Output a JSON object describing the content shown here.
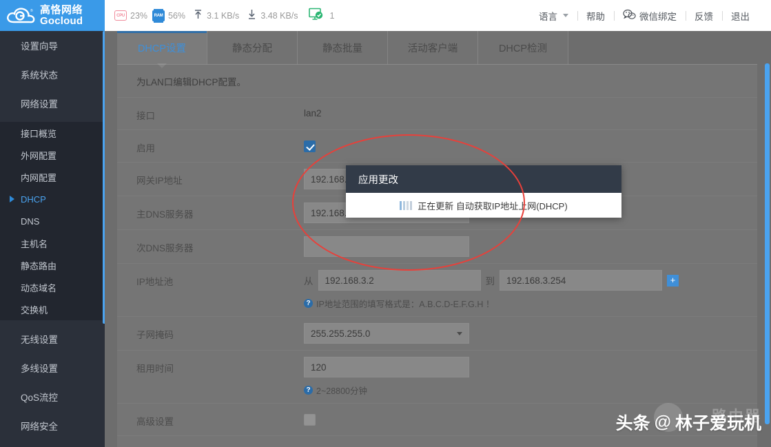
{
  "brand": {
    "cn": "高恪网络",
    "en": "Gocloud",
    "logo_icon": "cloud-logo-icon"
  },
  "header": {
    "stats": [
      {
        "icon": "cpu-icon",
        "label": "CPU",
        "value": "23%"
      },
      {
        "icon": "ram-icon",
        "label": "RAM",
        "value": "56%"
      },
      {
        "icon": "upload-arrow-icon",
        "value": "3.1 KB/s"
      },
      {
        "icon": "download-arrow-icon",
        "value": "3.48 KB/s"
      },
      {
        "icon": "device-online-icon",
        "value": "1"
      }
    ],
    "menu": [
      {
        "label": "语言",
        "icon": "chevron-down-icon"
      },
      {
        "label": "帮助"
      },
      {
        "label": "微信绑定",
        "icon": "wechat-icon"
      },
      {
        "label": "反馈"
      },
      {
        "label": "退出"
      }
    ]
  },
  "sidebar": {
    "items": [
      {
        "label": "设置向导"
      },
      {
        "label": "系统状态"
      },
      {
        "label": "网络设置"
      }
    ],
    "sub_items": [
      {
        "label": "接口概览",
        "active": false
      },
      {
        "label": "外网配置",
        "active": false
      },
      {
        "label": "内网配置",
        "active": false
      },
      {
        "label": "DHCP",
        "active": true
      },
      {
        "label": "DNS",
        "active": false
      },
      {
        "label": "主机名",
        "active": false
      },
      {
        "label": "静态路由",
        "active": false
      },
      {
        "label": "动态域名",
        "active": false
      },
      {
        "label": "交换机",
        "active": false
      }
    ],
    "items_after": [
      {
        "label": "无线设置"
      },
      {
        "label": "多线设置"
      },
      {
        "label": "QoS流控"
      },
      {
        "label": "网络安全"
      }
    ]
  },
  "tabs": [
    {
      "label": "DHCP设置",
      "active": true
    },
    {
      "label": "静态分配",
      "active": false
    },
    {
      "label": "静态批量",
      "active": false
    },
    {
      "label": "活动客户端",
      "active": false
    },
    {
      "label": "DHCP检测",
      "active": false
    }
  ],
  "panel": {
    "description": "为LAN口编辑DHCP配置。",
    "rows": {
      "interface_label": "接口",
      "interface_value": "lan2",
      "enable_label": "启用",
      "gateway_label": "网关IP地址",
      "gateway_value": "192.168.3.1",
      "dns1_label": "主DNS服务器",
      "dns1_value": "192.168.3.1",
      "dns2_label": "次DNS服务器",
      "dns2_value": "",
      "pool_label": "IP地址池",
      "pool_from_label": "从",
      "pool_from_value": "192.168.3.2",
      "pool_to_label": "到",
      "pool_to_value": "192.168.3.254",
      "pool_add_label": "+",
      "pool_hint": "IP地址范围的填写格式是：A.B.C.D-E.F.G.H ！",
      "netmask_label": "子网掩码",
      "netmask_value": "255.255.255.0",
      "lease_label": "租用时间",
      "lease_value": "120",
      "lease_hint": "2~28800分钟",
      "advanced_label": "高级设置"
    }
  },
  "modal": {
    "title": "应用更改",
    "message": "正在更新 自动获取IP地址上网(DHCP)",
    "spinner_colors": [
      "#8fb8dd",
      "#b9cee0",
      "#cfd9e2",
      "#c2cedb"
    ]
  },
  "annotation": {
    "shape": "red-ellipse",
    "color": "#e8403a"
  },
  "watermark": {
    "prefix": "头条",
    "at": "@",
    "name": "林子爱玩机",
    "ghost": "路由器"
  },
  "colors": {
    "brand_blue": "#3a9ae8",
    "accent_blue": "#2f8ad8",
    "sidebar_bg": "#2b303a",
    "modal_head": "#323b48",
    "annotation_red": "#e8403a"
  }
}
